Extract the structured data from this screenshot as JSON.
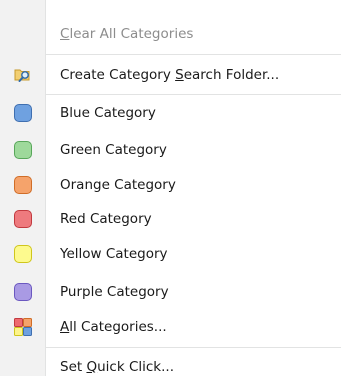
{
  "menu": {
    "clear_all": {
      "before": "",
      "key": "C",
      "after": "lear All Categories",
      "disabled": true
    },
    "search_folder": {
      "before": "Create Category ",
      "key": "S",
      "after": "earch Folder...",
      "icon": "folder-search-icon"
    },
    "categories": [
      {
        "label": "Blue Category",
        "fill": "#6fa1e0",
        "border": "#3f6fb0",
        "icon": "blue-category-icon"
      },
      {
        "label": "Green Category",
        "fill": "#9ed99b",
        "border": "#58a75a",
        "icon": "green-category-icon"
      },
      {
        "label": "Orange Category",
        "fill": "#f5a36b",
        "border": "#d06d27",
        "icon": "orange-category-icon"
      },
      {
        "label": "Red Category",
        "fill": "#ee7a7e",
        "border": "#c23a3f",
        "icon": "red-category-icon"
      },
      {
        "label": "Yellow Category",
        "fill": "#fdfa8e",
        "border": "#cfc61c",
        "icon": "yellow-category-icon"
      },
      {
        "label": "Purple Category",
        "fill": "#a99ae4",
        "border": "#6b58c0",
        "icon": "purple-category-icon"
      }
    ],
    "all_categories": {
      "before": "",
      "key": "A",
      "after": "ll Categories...",
      "icon": "all-categories-icon"
    },
    "quick_click": {
      "before": "Set ",
      "key": "Q",
      "after": "uick Click..."
    }
  }
}
